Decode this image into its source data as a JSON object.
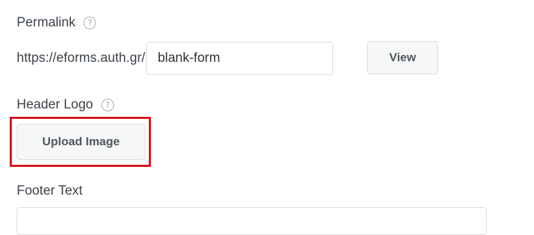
{
  "permalink": {
    "label": "Permalink",
    "help_icon": "question-circle-icon",
    "prefix": "https://eforms.auth.gr/",
    "slug_value": "blank-form",
    "view_label": "View"
  },
  "header_logo": {
    "label": "Header Logo",
    "help_icon": "question-circle-icon",
    "upload_label": "Upload Image",
    "highlight_color": "#d1131b"
  },
  "footer_text": {
    "label": "Footer Text",
    "value": ""
  }
}
